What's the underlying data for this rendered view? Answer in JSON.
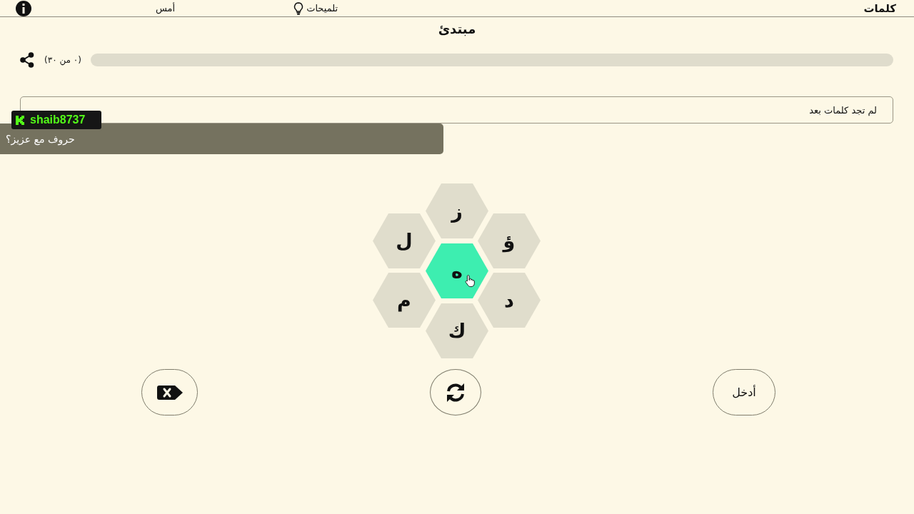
{
  "header": {
    "logo": "كلمات",
    "links": [
      {
        "label": "تلميحات",
        "kind": "hints"
      },
      {
        "label": "أمس",
        "kind": "plain"
      }
    ]
  },
  "title": "مبتدئ",
  "progress": {
    "reading": "(٠ من ٣٠)",
    "level": 0
  },
  "found_words": {
    "message": "لم تجد كلمات بعد"
  },
  "letters": [
    {
      "letter": "ز",
      "kind": "outer"
    },
    {
      "letter": "ؤ",
      "kind": "outer"
    },
    {
      "letter": "ل",
      "kind": "outer"
    },
    {
      "letter": "ه",
      "kind": "center"
    },
    {
      "letter": "د",
      "kind": "outer"
    },
    {
      "letter": "م",
      "kind": "outer"
    },
    {
      "letter": "ك",
      "kind": "outer"
    }
  ],
  "buttons": [
    {
      "kind": "delete"
    },
    {
      "kind": "shuffle"
    },
    {
      "kind": "enter",
      "label": "أدخل"
    }
  ],
  "chat_overlay": {
    "username": "shaib8737",
    "message": "حروف مع عزيز؟"
  }
}
